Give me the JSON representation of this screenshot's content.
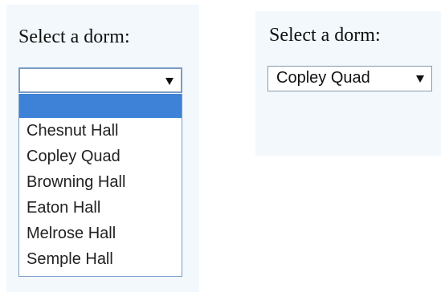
{
  "left_widget": {
    "prompt": "Select a dorm:",
    "selected_value": "",
    "expanded": true,
    "options": [
      "",
      "Chesnut Hall",
      "Copley Quad",
      "Browning Hall",
      "Eaton Hall",
      "Melrose Hall",
      "Semple Hall"
    ],
    "highlighted_index": 0
  },
  "right_widget": {
    "prompt": "Select a dorm:",
    "selected_value": "Copley Quad",
    "expanded": false
  },
  "colors": {
    "panel_background": "#f2f8fc",
    "highlight": "#3d82d6",
    "select_border": "#7a9cc6"
  },
  "icons": {
    "dropdown_arrow": "triangle-down-icon"
  }
}
